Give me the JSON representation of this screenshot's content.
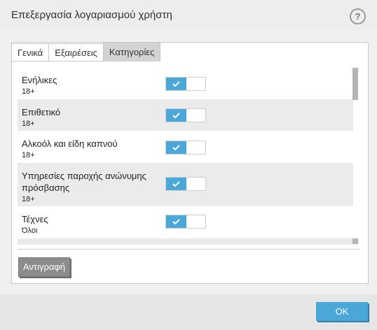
{
  "dialog": {
    "title": "Επεξεργασία λογαριασμού χρήστη",
    "help_label": "?"
  },
  "tabs": [
    {
      "label": "Γενικά",
      "active": false
    },
    {
      "label": "Εξαιρέσεις",
      "active": false
    },
    {
      "label": "Κατηγορίες",
      "active": true
    }
  ],
  "categories": [
    {
      "name": "Ενήλικες",
      "age": "18+",
      "enabled": true
    },
    {
      "name": "Επιθετικό",
      "age": "18+",
      "enabled": true
    },
    {
      "name": "Αλκοόλ και είδη καπνού",
      "age": "18+",
      "enabled": true
    },
    {
      "name": "Υπηρεσίες παροχής ανώνυμης πρόσβασης",
      "age": "18+",
      "enabled": true
    },
    {
      "name": "Τέχνες",
      "age": "Όλοι",
      "enabled": true
    }
  ],
  "buttons": {
    "copy_label": "Αντιγραφή",
    "ok_label": "OK"
  },
  "colors": {
    "accent": "#4aa7d8",
    "toggle_on": "#4aa7d8",
    "alt_row": "#ebebeb",
    "copy_button": "#8c8c8c"
  },
  "icons": {
    "toggle_on": "checkmark-icon",
    "help": "question-mark-icon"
  }
}
